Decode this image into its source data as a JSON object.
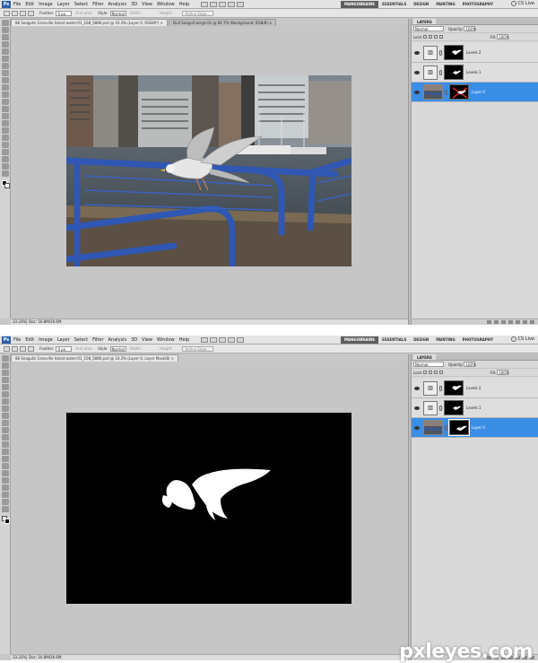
{
  "app": {
    "logo": "Ps",
    "menu": [
      "File",
      "Edit",
      "Image",
      "Layer",
      "Select",
      "Filter",
      "Analysis",
      "3D",
      "View",
      "Window",
      "Help"
    ],
    "workspaces": [
      "MANGOBRAINS",
      "ESSENTIALS",
      "DESIGN",
      "PAINTING",
      "PHOTOGRAPHY"
    ],
    "active_workspace": "MANGOBRAINS",
    "cs_live": "CS Live"
  },
  "options_bar": {
    "feather_label": "Feather:",
    "feather_value": "0 px",
    "antialias_label": "Anti-alias",
    "style_label": "Style:",
    "style_value": "Normal",
    "width_label": "Width:",
    "height_label": "Height:",
    "refine_label": "Refine Edge..."
  },
  "screens": [
    {
      "doc_tabs": [
        "88 Seagulls Granville Island water-01_108_5880.psd @ 33.3% (Layer 0, RGB/8*) ×",
        "Dull Seagull wings-01 @ 66.7% (Background, RGB/8) ×"
      ],
      "status_zoom": "33.33%",
      "status_doc": "Doc: 16.8M/26.6M",
      "view": "photo"
    },
    {
      "doc_tabs": [
        "88 Seagulls Granville Island water-01_108_5880.psd @ 33.3% (Layer 0, Layer Mask/8) ×"
      ],
      "status_zoom": "33.33%",
      "status_doc": "Doc: 16.8M/26.6M",
      "view": "mask"
    }
  ],
  "layers_panel": {
    "title": "LAYERS",
    "blend_mode": "Normal",
    "opacity_label": "Opacity:",
    "opacity_value": "100%",
    "lock_label": "Lock:",
    "fill_label": "Fill:",
    "fill_value": "100%",
    "layers": [
      {
        "name": "Levels 2",
        "selected": false,
        "kind": "adjustment"
      },
      {
        "name": "Levels 1",
        "selected": false,
        "kind": "adjustment"
      },
      {
        "name": "Layer 0",
        "selected": true,
        "kind": "pixel"
      }
    ]
  },
  "watermark": "pxleyes.com"
}
